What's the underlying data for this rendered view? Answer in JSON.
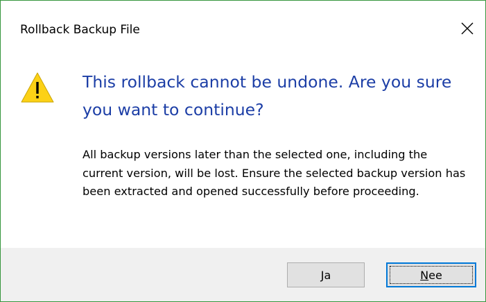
{
  "dialog": {
    "title": "Rollback Backup File",
    "main_instruction": "This rollback cannot be undone. Are you sure you want to continue?",
    "body_text": "All backup versions later than the selected one, including the current version, will be lost. Ensure the selected backup version has been extracted and opened successfully before proceeding.",
    "icon": "warning-icon",
    "close_icon": "close-icon"
  },
  "buttons": {
    "yes": {
      "mnemonic": "J",
      "rest": "a"
    },
    "no": {
      "mnemonic": "N",
      "rest": "ee"
    }
  },
  "colors": {
    "border": "#36963d",
    "instruction": "#1c3ea6",
    "footer_bg": "#f0f0f0",
    "button_bg": "#e1e1e1",
    "focus_border": "#0078d7",
    "warning_fill": "#fcd116"
  }
}
